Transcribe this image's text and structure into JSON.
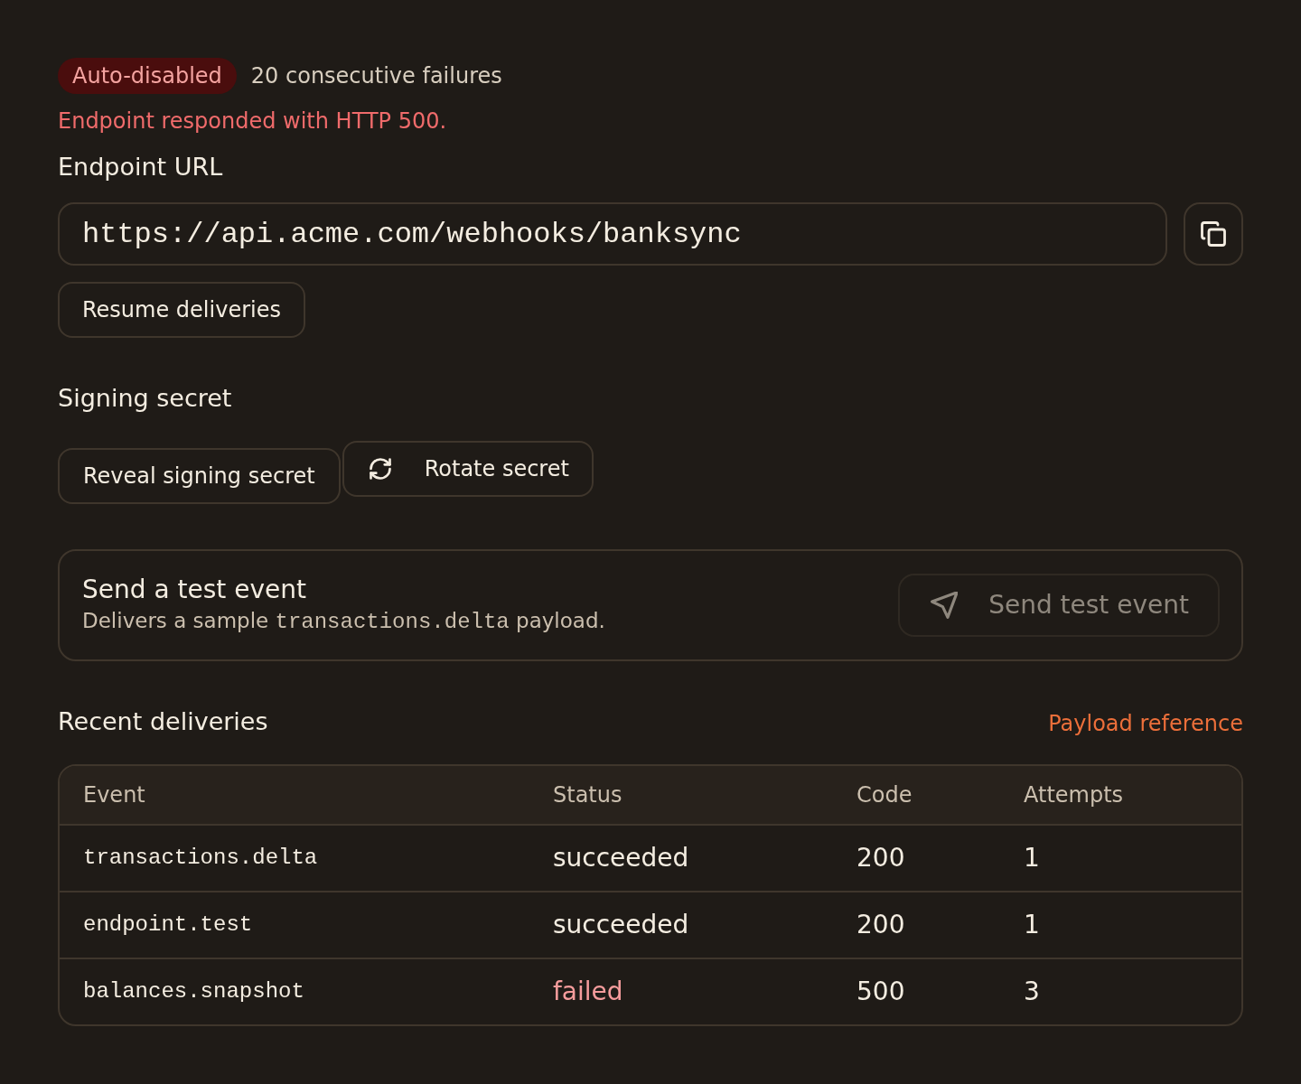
{
  "status": {
    "badge": "Auto-disabled",
    "failure_count": "20 consecutive failures",
    "error": "Endpoint responded with HTTP 500."
  },
  "endpoint": {
    "label": "Endpoint URL",
    "url": "https://api.acme.com/webhooks/banksync",
    "resume_button": "Resume deliveries"
  },
  "signing_secret": {
    "title": "Signing secret",
    "buttons": [
      {
        "kind": "plain",
        "label": "Reveal signing secret"
      },
      {
        "kind": "rotate",
        "label": "Rotate secret"
      }
    ]
  },
  "test_event": {
    "title": "Send a test event",
    "description": [
      {
        "kind": "text",
        "text": "Delivers a sample "
      },
      {
        "kind": "code",
        "text": "transactions.delta"
      },
      {
        "kind": "text",
        "text": " payload."
      }
    ],
    "button": {
      "label": "Send test event",
      "disabled": true
    }
  },
  "recent_deliveries": {
    "title": "Recent deliveries",
    "link": "Payload reference",
    "table": {
      "columns": [
        "Event",
        "Status",
        "Code",
        "Attempts"
      ],
      "rows": [
        {
          "event": "transactions.delta",
          "status": "succeeded",
          "failed": false,
          "code": "200",
          "attempts": "1"
        },
        {
          "event": "endpoint.test",
          "status": "succeeded",
          "failed": false,
          "code": "200",
          "attempts": "1"
        },
        {
          "event": "balances.snapshot",
          "status": "failed",
          "failed": true,
          "code": "500",
          "attempts": "3"
        }
      ]
    }
  }
}
